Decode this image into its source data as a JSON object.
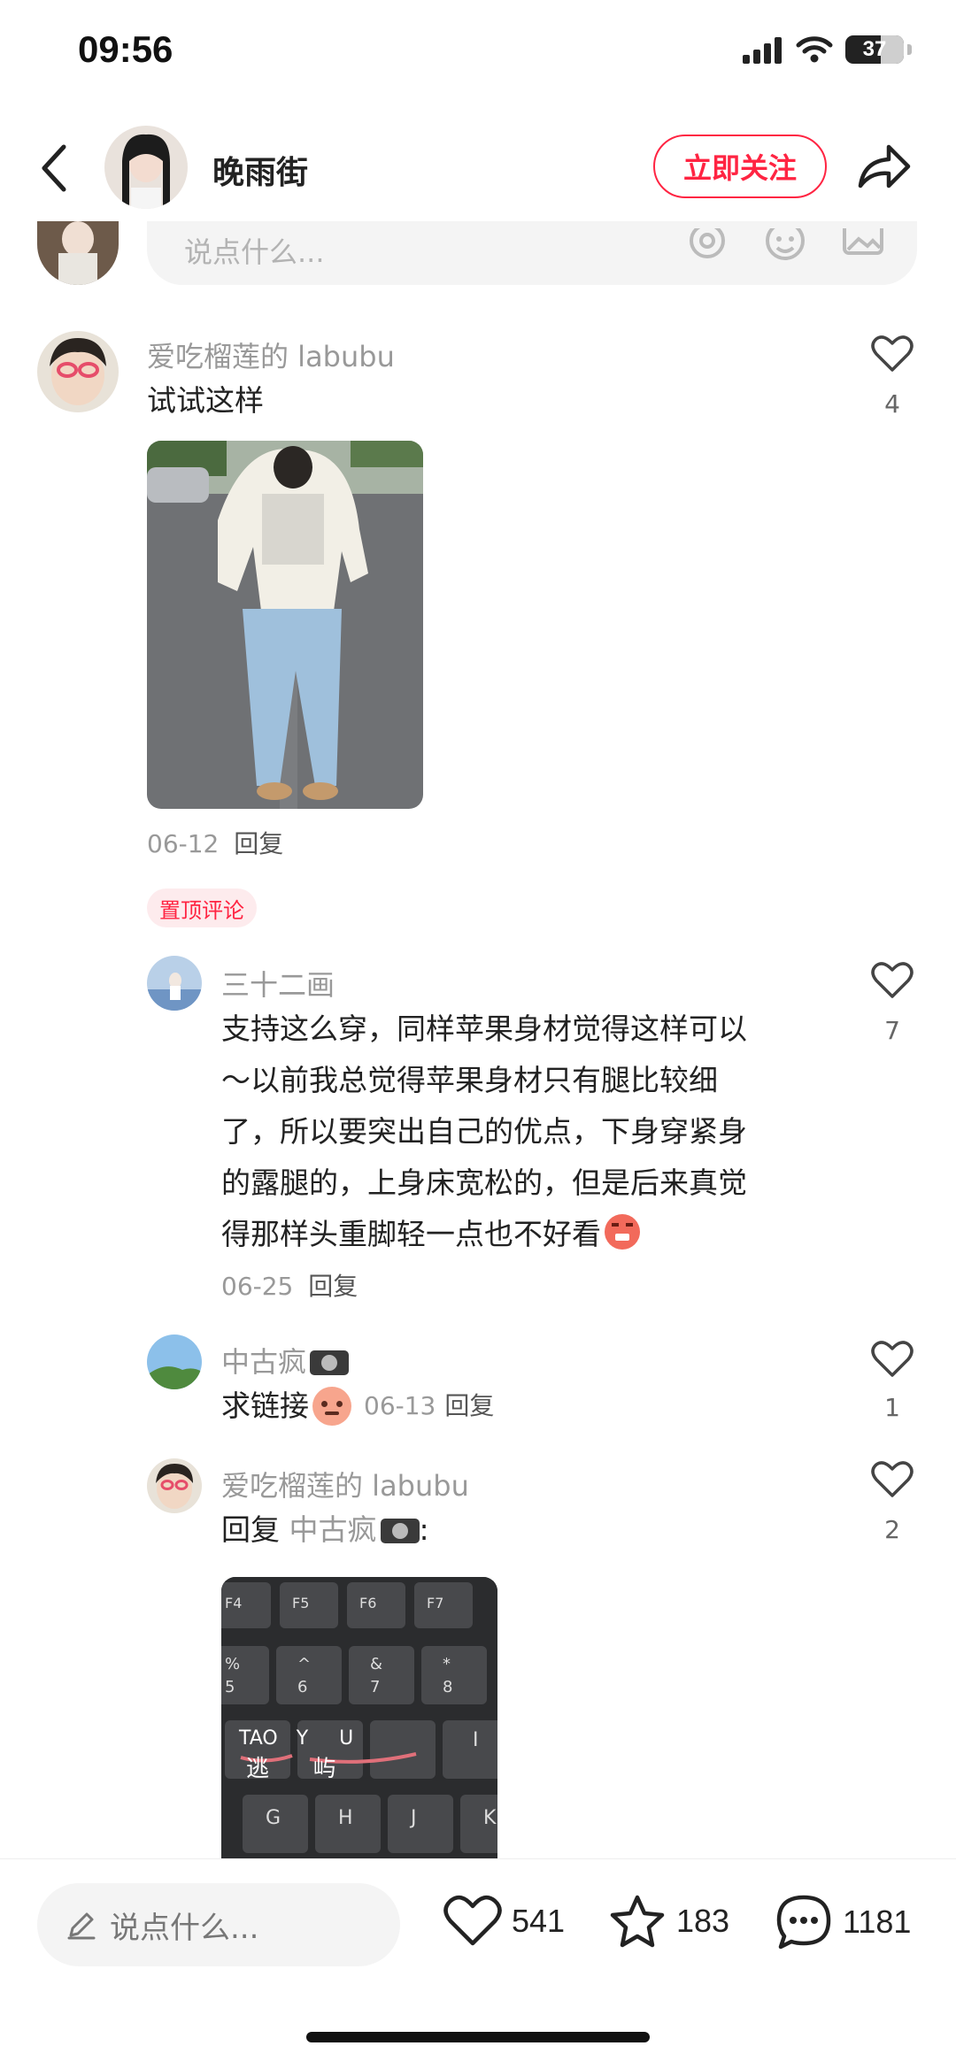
{
  "status_bar": {
    "time": "09:56",
    "battery": "37"
  },
  "header": {
    "author_name": "晚雨街",
    "follow_label": "立即关注"
  },
  "comment_input": {
    "placeholder": "说点什么..."
  },
  "comments": [
    {
      "user": "爱吃榴莲的 labubu",
      "text": "试试这样",
      "likes": "4",
      "date": "06-12",
      "reply_label": "回复"
    }
  ],
  "pinned_label": "置顶评论",
  "replies": [
    {
      "user": "三十二画",
      "text_lines": [
        "支持这么穿，同样苹果身材觉得这样可以",
        "～以前我总觉得苹果身材只有腿比较细",
        "了，所以要突出自己的优点，下身穿紧身",
        "的露腿的，上身床宽松的，但是后来真觉",
        "得那样头重脚轻一点也不好看"
      ],
      "likes": "7",
      "date": "06-25",
      "reply_label": "回复"
    },
    {
      "user": "中古疯",
      "text": "求链接",
      "likes": "1",
      "date": "06-13",
      "reply_label": "回复"
    },
    {
      "user": "爱吃榴莲的 labubu",
      "reply_prefix": "回复",
      "reply_to": "中古疯",
      "colon": ":",
      "likes": "2",
      "keyboard": {
        "row1": [
          "F4",
          "F5",
          "F6",
          "F7"
        ],
        "row2": [
          [
            "%",
            "5"
          ],
          [
            "^",
            "6"
          ],
          [
            "&",
            "7"
          ],
          [
            "*",
            "8"
          ]
        ],
        "row3": [
          "T",
          "Y",
          "U",
          "I"
        ],
        "row4": [
          "G",
          "H",
          "J",
          "K"
        ],
        "overlay_top": "TAO   Y     U",
        "overlay_bottom": "逃      屿"
      }
    }
  ],
  "bottom_bar": {
    "placeholder": "说点什么...",
    "likes": "541",
    "stars": "183",
    "comments": "1181"
  },
  "colors": {
    "accent": "#ff2442",
    "muted": "#999999",
    "bg_input": "#f4f4f4"
  }
}
